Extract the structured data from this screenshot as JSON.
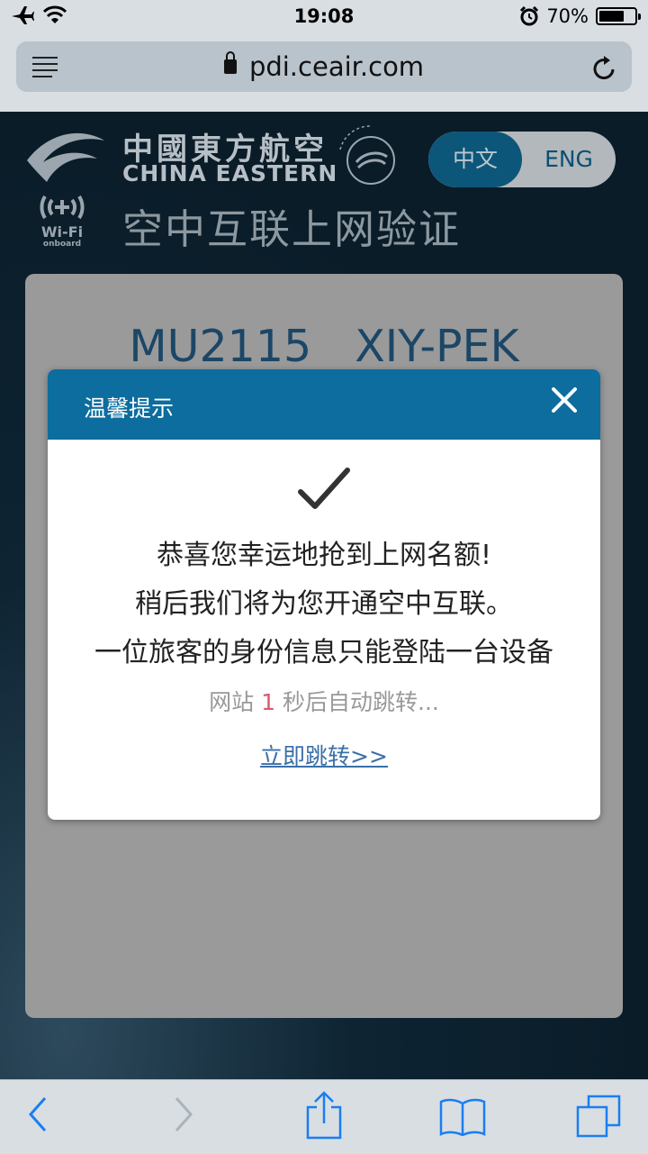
{
  "status_bar": {
    "time": "19:08",
    "battery": "70%",
    "battery_level": 0.7
  },
  "browser": {
    "url": "pdi.ceair.com"
  },
  "header": {
    "brand_cn": "中國東方航空",
    "brand_en": "CHINA EASTERN",
    "lang_cn": "中文",
    "lang_en": "ENG",
    "wifi_label": "Wi-Fi",
    "wifi_sub": "onboard",
    "title": "空中互联上网验证"
  },
  "card": {
    "flight_no": "MU2115",
    "route": "XIY-PEK"
  },
  "modal": {
    "title": "温馨提示",
    "line1": "恭喜您幸运地抢到上网名额!",
    "line2": "稍后我们将为您开通空中互联。",
    "line3": "一位旅客的身份信息只能登陆一台设备",
    "countdown_prefix": "网站",
    "countdown_num": "1",
    "countdown_suffix": "秒后自动跳转...",
    "jump_link": "立即跳转>>"
  },
  "colors": {
    "header_blue": "#0c6d9e",
    "flight_text": "#1c4666",
    "countdown_num": "#d65a6b",
    "link": "#3a6fa8"
  },
  "icons": [
    "airplane-icon",
    "wifi-icon",
    "alarm-icon",
    "battery-icon",
    "menu-icon",
    "lock-icon",
    "reload-icon",
    "close-icon",
    "checkmark-icon",
    "back-icon",
    "forward-icon",
    "share-icon",
    "bookmarks-icon",
    "tabs-icon"
  ]
}
